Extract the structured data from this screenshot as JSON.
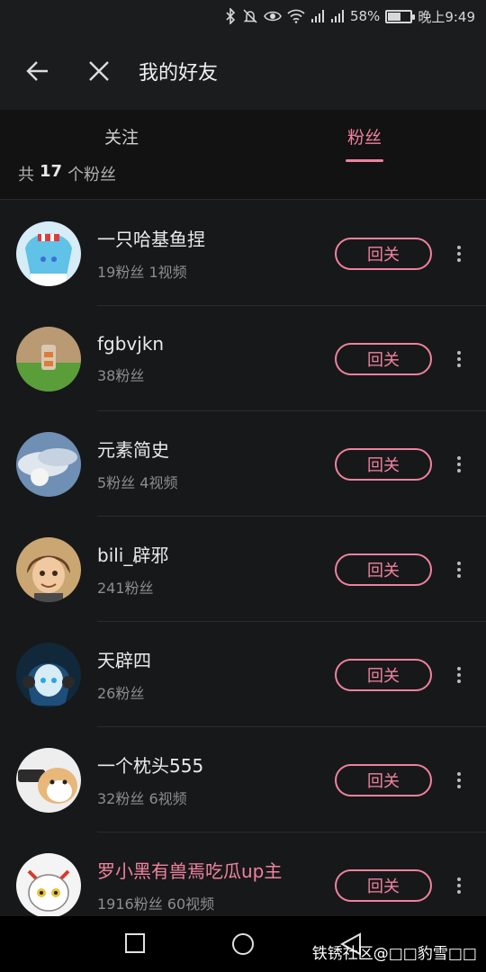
{
  "status": {
    "battery": "58%",
    "battery_level": 0.58,
    "time": "晚上9:49",
    "icons": [
      "bluetooth-icon",
      "mute-icon",
      "eye-icon",
      "wifi-icon",
      "signal-icon",
      "signal-icon",
      "battery-icon"
    ]
  },
  "header": {
    "title": "我的好友"
  },
  "tabs": [
    {
      "label": "关注",
      "active": false
    },
    {
      "label": "粉丝",
      "active": true
    }
  ],
  "count": {
    "prefix": "共",
    "value": "17",
    "suffix": "个粉丝"
  },
  "fans": [
    {
      "name": "一只哈基鱼捏",
      "meta": "19粉丝 1视频",
      "button": "回关",
      "vip": false
    },
    {
      "name": "fgbvjkn",
      "meta": "38粉丝",
      "button": "回关",
      "vip": false
    },
    {
      "name": "元素简史",
      "meta": "5粉丝 4视频",
      "button": "回关",
      "vip": false
    },
    {
      "name": "bili_辟邪",
      "meta": "241粉丝",
      "button": "回关",
      "vip": false
    },
    {
      "name": "天辟四",
      "meta": "26粉丝",
      "button": "回关",
      "vip": false
    },
    {
      "name": "一个枕头555",
      "meta": "32粉丝 6视频",
      "button": "回关",
      "vip": false
    },
    {
      "name": "罗小黑有兽焉吃瓜up主",
      "meta": "1916粉丝 60视频",
      "button": "回关",
      "vip": true
    }
  ],
  "watermark": "铁锈社区@□□豹雪□□",
  "colors": {
    "accent": "#f0829e",
    "background": "#17181a"
  }
}
